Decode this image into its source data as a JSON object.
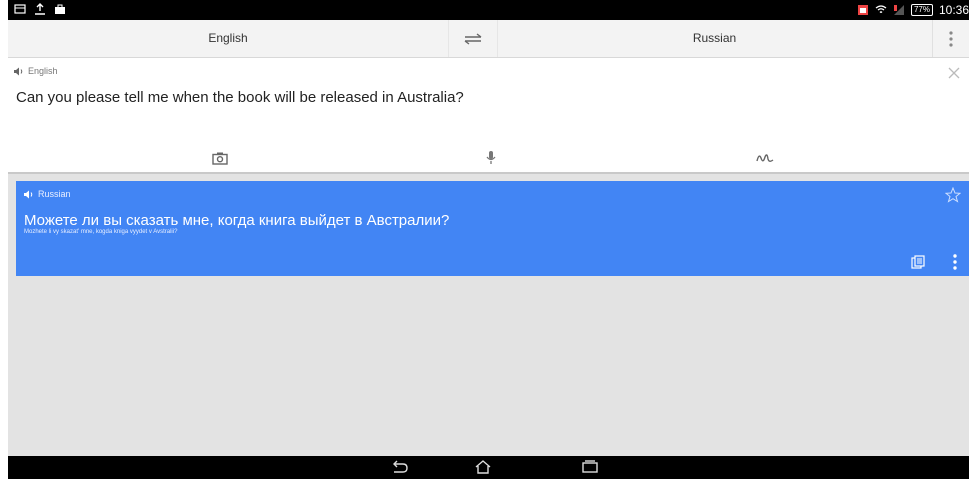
{
  "status_bar": {
    "time": "10:36",
    "battery_label": "77%",
    "icons": [
      "screenshot-icon",
      "upload-icon",
      "bag-icon",
      "sim-icon",
      "wifi-icon",
      "signal-icon",
      "battery-icon"
    ]
  },
  "language_bar": {
    "source_language": "English",
    "target_language": "Russian",
    "swap_icon": "swap-arrows-icon",
    "menu_icon": "overflow-menu-icon"
  },
  "input": {
    "language_label": "English",
    "text": "Can you please tell me when the book will be released in Australia?",
    "clear_icon": "close-icon"
  },
  "tools": {
    "camera_icon": "camera-icon",
    "mic_icon": "microphone-icon",
    "handwriting_icon": "handwriting-icon"
  },
  "result": {
    "language_label": "Russian",
    "text": "Можете ли вы сказать мне, когда книга выйдет в Австралии?",
    "transliteration": "Mozhete li vy skazat' mne, kogda kniga vyydet v Avstralii?",
    "color": "#4285f4",
    "star_icon": "star-outline-icon",
    "copy_icon": "copy-icon",
    "menu_icon": "overflow-menu-icon"
  },
  "nav_bar": {
    "icons": [
      "back-icon",
      "home-icon",
      "recents-icon"
    ]
  }
}
